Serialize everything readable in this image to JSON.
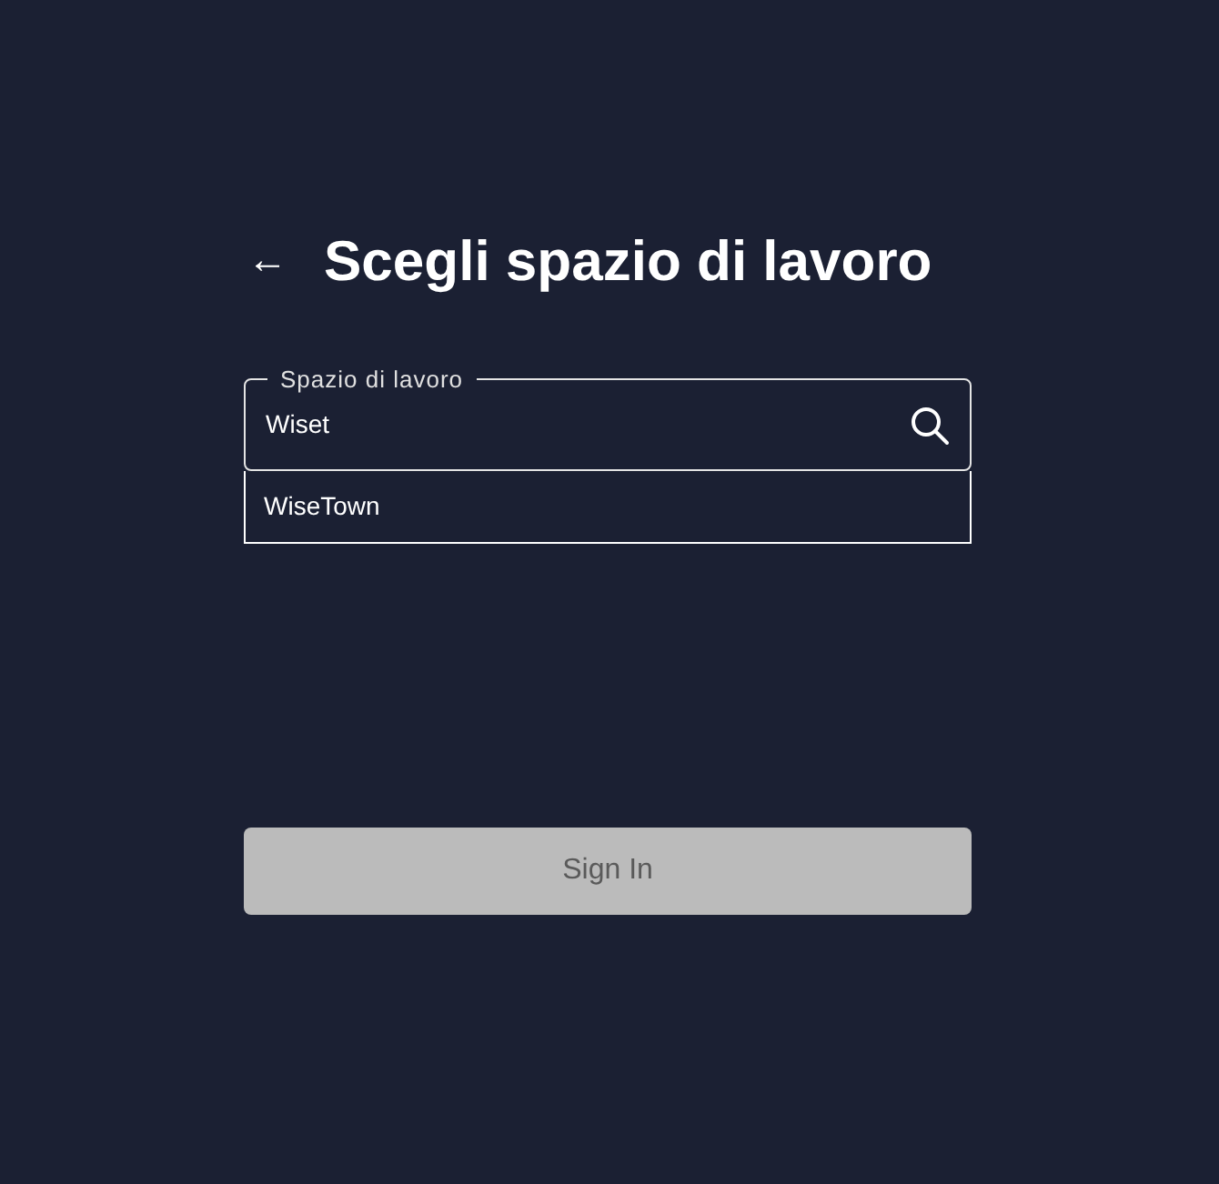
{
  "header": {
    "back_icon": "←",
    "title": "Scegli spazio di lavoro"
  },
  "workspace_field": {
    "label": "Spazio di lavoro",
    "value": "Wiset"
  },
  "suggestions": [
    {
      "label": "WiseTown"
    }
  ],
  "sign_in_button": {
    "label": "Sign In",
    "disabled": true
  }
}
